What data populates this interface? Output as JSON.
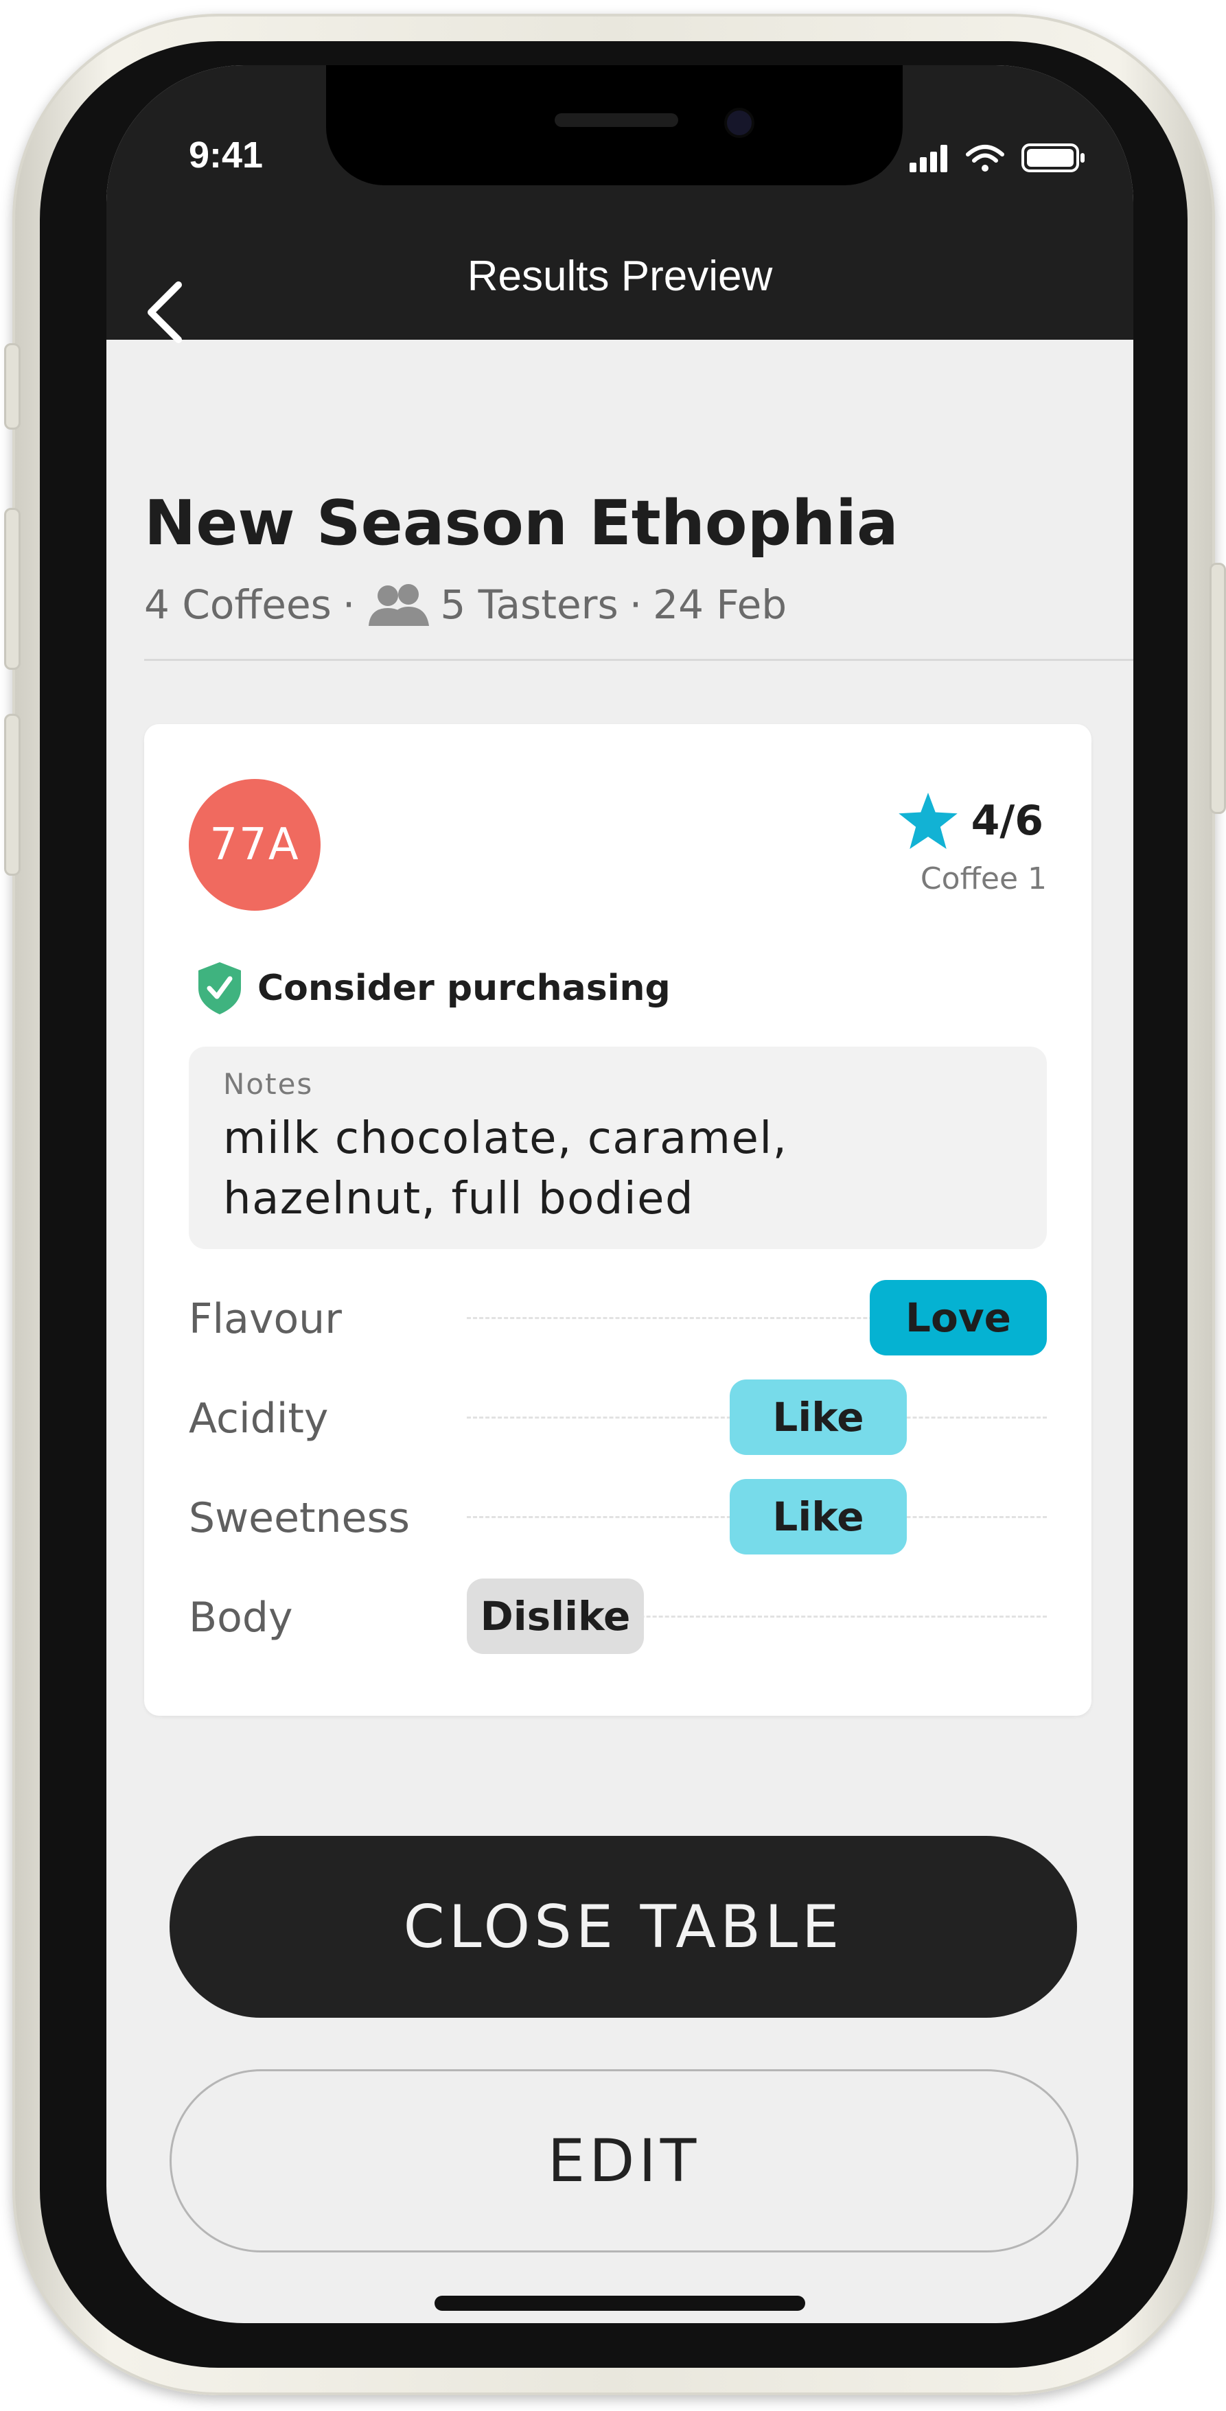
{
  "status_bar": {
    "time": "9:41"
  },
  "header": {
    "title": "Results Preview"
  },
  "session": {
    "title": "New Season Ethophia",
    "coffees": "4 Coffees",
    "separator": "·",
    "tasters": "5 Tasters",
    "date": "24 Feb"
  },
  "coffee_card": {
    "code": "77A",
    "rating": "4/6",
    "coffee_label": "Coffee 1",
    "recommendation": "Consider purchasing",
    "notes_label": "Notes",
    "notes_text": "milk chocolate, caramel, hazelnut, full bodied",
    "attributes": [
      {
        "name": "Flavour",
        "value": "Love"
      },
      {
        "name": "Acidity",
        "value": "Like"
      },
      {
        "name": "Sweetness",
        "value": "Like"
      },
      {
        "name": "Body",
        "value": "Dislike"
      }
    ]
  },
  "actions": {
    "close_label": "CLOSE TABLE",
    "edit_label": "EDIT"
  },
  "colors": {
    "header_bg": "#1f1f1f",
    "badge": "#f06a5f",
    "accent_star": "#12b2d4",
    "love": "#05b2d2",
    "like": "#77dbea",
    "dislike": "#dedede",
    "shield": "#3fb37f"
  },
  "icons": {
    "back": "chevron-left-icon",
    "tasters": "group-icon",
    "rating": "star-icon",
    "recommendation": "shield-check-icon"
  }
}
